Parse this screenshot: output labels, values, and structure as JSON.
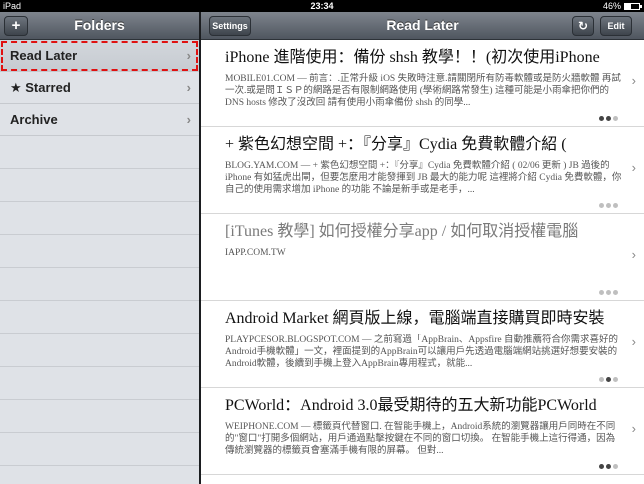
{
  "status_bar": {
    "device": "iPad",
    "time": "23:34",
    "battery": "46%",
    "battery_level": 0.46
  },
  "folders": {
    "title": "Folders",
    "add_label": "+",
    "items": [
      {
        "label": "Read Later",
        "selected": true
      },
      {
        "label": "★ Starred",
        "selected": false
      },
      {
        "label": "Archive",
        "selected": false
      }
    ]
  },
  "reader": {
    "title": "Read Later",
    "settings_label": "Settings",
    "refresh_icon": "↻",
    "edit_label": "Edit",
    "articles": [
      {
        "title": "iPhone 進階使用：備份 shsh 教學！！(初次使用iPhone",
        "snippet": "MOBILE01.COM — 前言：.正常升級 iOS 失敗時注意.請關閉所有防毒軟體或是防火牆軟體 再試一次.或是問ＩＳＰ的網路是否有限制網路使用 (學術網路常發生) 這種可能是小雨傘把你們的DNS hosts 修改了沒改回 請有使用小雨傘備份 shsh 的同學..."
      },
      {
        "title": "+ 紫色幻想空間 +：『分享』Cydia 免費軟體介紹 (",
        "snippet": "BLOG.YAM.COM — + 紫色幻想空間 +：『分享』Cydia 免費軟體介紹 ( 02/06 更新 ) JB 過後的 iPhone 有如猛虎出閘，但要怎麼用才能發揮到 JB 最大的能力呢 這裡將介紹 Cydia 免費軟體，你自己的使用需求增加 iPhone 的功能 不論是新手或是老手，..."
      },
      {
        "title": "[iTunes 教學] 如何授權分享app / 如何取消授權電腦",
        "snippet": "IAPP.COM.TW",
        "read": true
      },
      {
        "title": "Android Market 網頁版上線，電腦端直接購買即時安裝",
        "snippet": "PLAYPCESOR.BLOGSPOT.COM — 之前寫過「AppBrain、Appsfire 自動推薦符合你需求喜好的Android手機軟體」一文，裡面提到的AppBrain可以讓用戶先透過電腦端網站挑選好想要安裝的Android軟體，後續到手機上登入AppBrain專用程式，就能..."
      },
      {
        "title": "PCWorld：Android 3.0最受期待的五大新功能PCWorld",
        "snippet": "WEIPHONE.COM — 標籤頁代替窗口. 在智能手機上，Android系統的瀏覽器讓用戶同時在不同的\"窗口\"打開多個網站，用戶通過點擊按鍵在不同的窗口切換。 在智能手機上這行得通，因為傳統瀏覽器的標籤頁會塞滿手機有限的屏幕。 但對..."
      }
    ]
  }
}
